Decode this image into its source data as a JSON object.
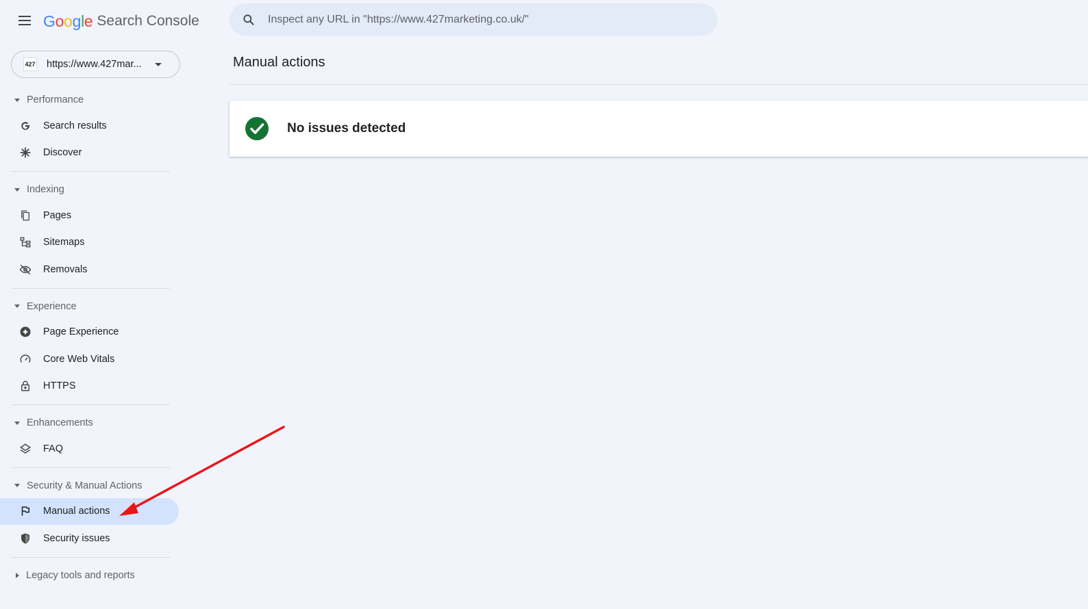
{
  "header": {
    "logo_google": [
      "G",
      "o",
      "o",
      "g",
      "l",
      "e"
    ],
    "logo_product": "Search Console",
    "search_placeholder": "Inspect any URL in \"https://www.427marketing.co.uk/\""
  },
  "property": {
    "favicon_text": "427",
    "url": "https://www.427mar..."
  },
  "sidebar": {
    "sections": [
      {
        "label": "Performance",
        "items": [
          {
            "label": "Search results",
            "icon": "google-g-icon"
          },
          {
            "label": "Discover",
            "icon": "asterisk-icon"
          }
        ]
      },
      {
        "label": "Indexing",
        "items": [
          {
            "label": "Pages",
            "icon": "pages-icon"
          },
          {
            "label": "Sitemaps",
            "icon": "sitemap-icon"
          },
          {
            "label": "Removals",
            "icon": "eye-off-icon"
          }
        ]
      },
      {
        "label": "Experience",
        "items": [
          {
            "label": "Page Experience",
            "icon": "plus-circle-icon"
          },
          {
            "label": "Core Web Vitals",
            "icon": "speedometer-icon"
          },
          {
            "label": "HTTPS",
            "icon": "lock-icon"
          }
        ]
      },
      {
        "label": "Enhancements",
        "items": [
          {
            "label": "FAQ",
            "icon": "layers-icon"
          }
        ]
      },
      {
        "label": "Security & Manual Actions",
        "items": [
          {
            "label": "Manual actions",
            "icon": "flag-icon",
            "active": true
          },
          {
            "label": "Security issues",
            "icon": "shield-icon"
          }
        ]
      },
      {
        "label": "Legacy tools and reports",
        "items": []
      }
    ]
  },
  "main": {
    "title": "Manual actions",
    "status": "No issues detected"
  },
  "colors": {
    "background": "#f1f4fb",
    "active_item": "#d3e3fd",
    "success": "#137333",
    "annotation_arrow": "#e8161b"
  }
}
